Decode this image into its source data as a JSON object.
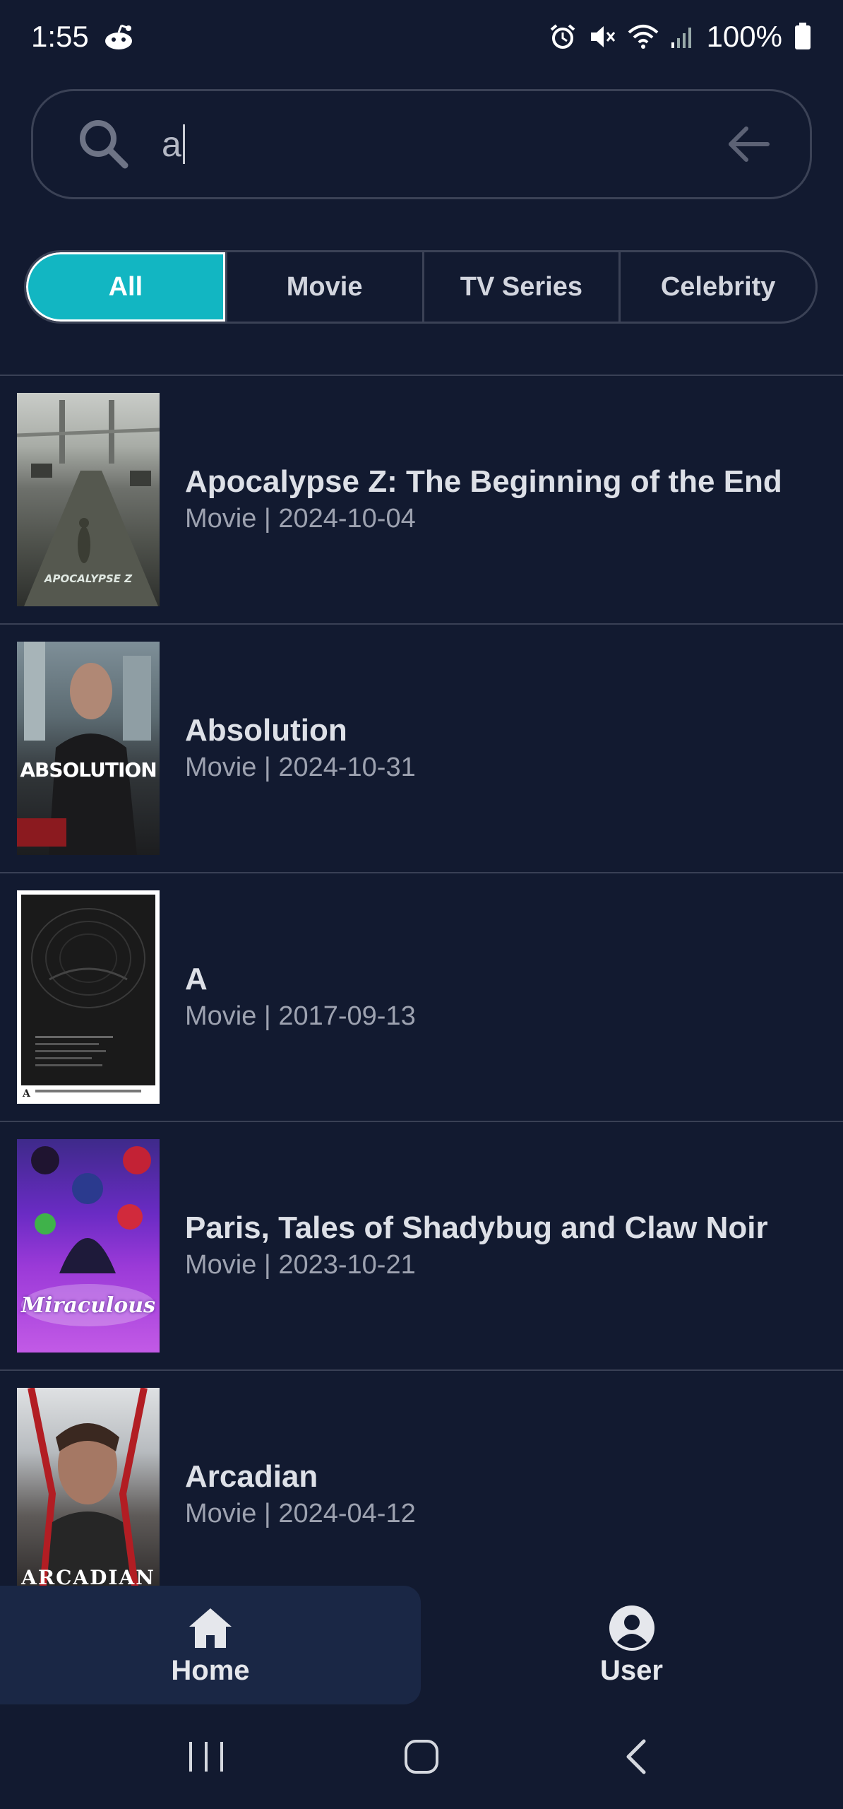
{
  "status_bar": {
    "time": "1:55",
    "battery": "100%",
    "icons": [
      "reddit-icon",
      "alarm-icon",
      "mute-icon",
      "wifi-icon",
      "signal-icon",
      "battery-icon"
    ]
  },
  "search": {
    "value": "a",
    "icons": [
      "search-icon",
      "back-arrow-icon"
    ]
  },
  "filters": {
    "tabs": [
      {
        "label": "All",
        "active": true
      },
      {
        "label": "Movie",
        "active": false
      },
      {
        "label": "TV Series",
        "active": false
      },
      {
        "label": "Celebrity",
        "active": false
      }
    ]
  },
  "results": [
    {
      "title": "Apocalypse Z: The Beginning of the End",
      "meta": "Movie | 2024-10-04",
      "poster_text": "APOCALYPSE Z"
    },
    {
      "title": "Absolution",
      "meta": "Movie | 2024-10-31",
      "poster_text": "ABSOLUTION"
    },
    {
      "title": "A",
      "meta": "Movie | 2017-09-13",
      "poster_text": "A"
    },
    {
      "title": "Paris, Tales of Shadybug and Claw Noir",
      "meta": "Movie | 2023-10-21",
      "poster_text": "Miraculous"
    },
    {
      "title": "Arcadian",
      "meta": "Movie | 2024-04-12",
      "poster_text": "ARCADIAN"
    }
  ],
  "bottom_nav": {
    "home_label": "Home",
    "user_label": "User"
  },
  "colors": {
    "background": "#121a30",
    "accent": "#12b6c2",
    "nav_active": "#1a2745"
  }
}
